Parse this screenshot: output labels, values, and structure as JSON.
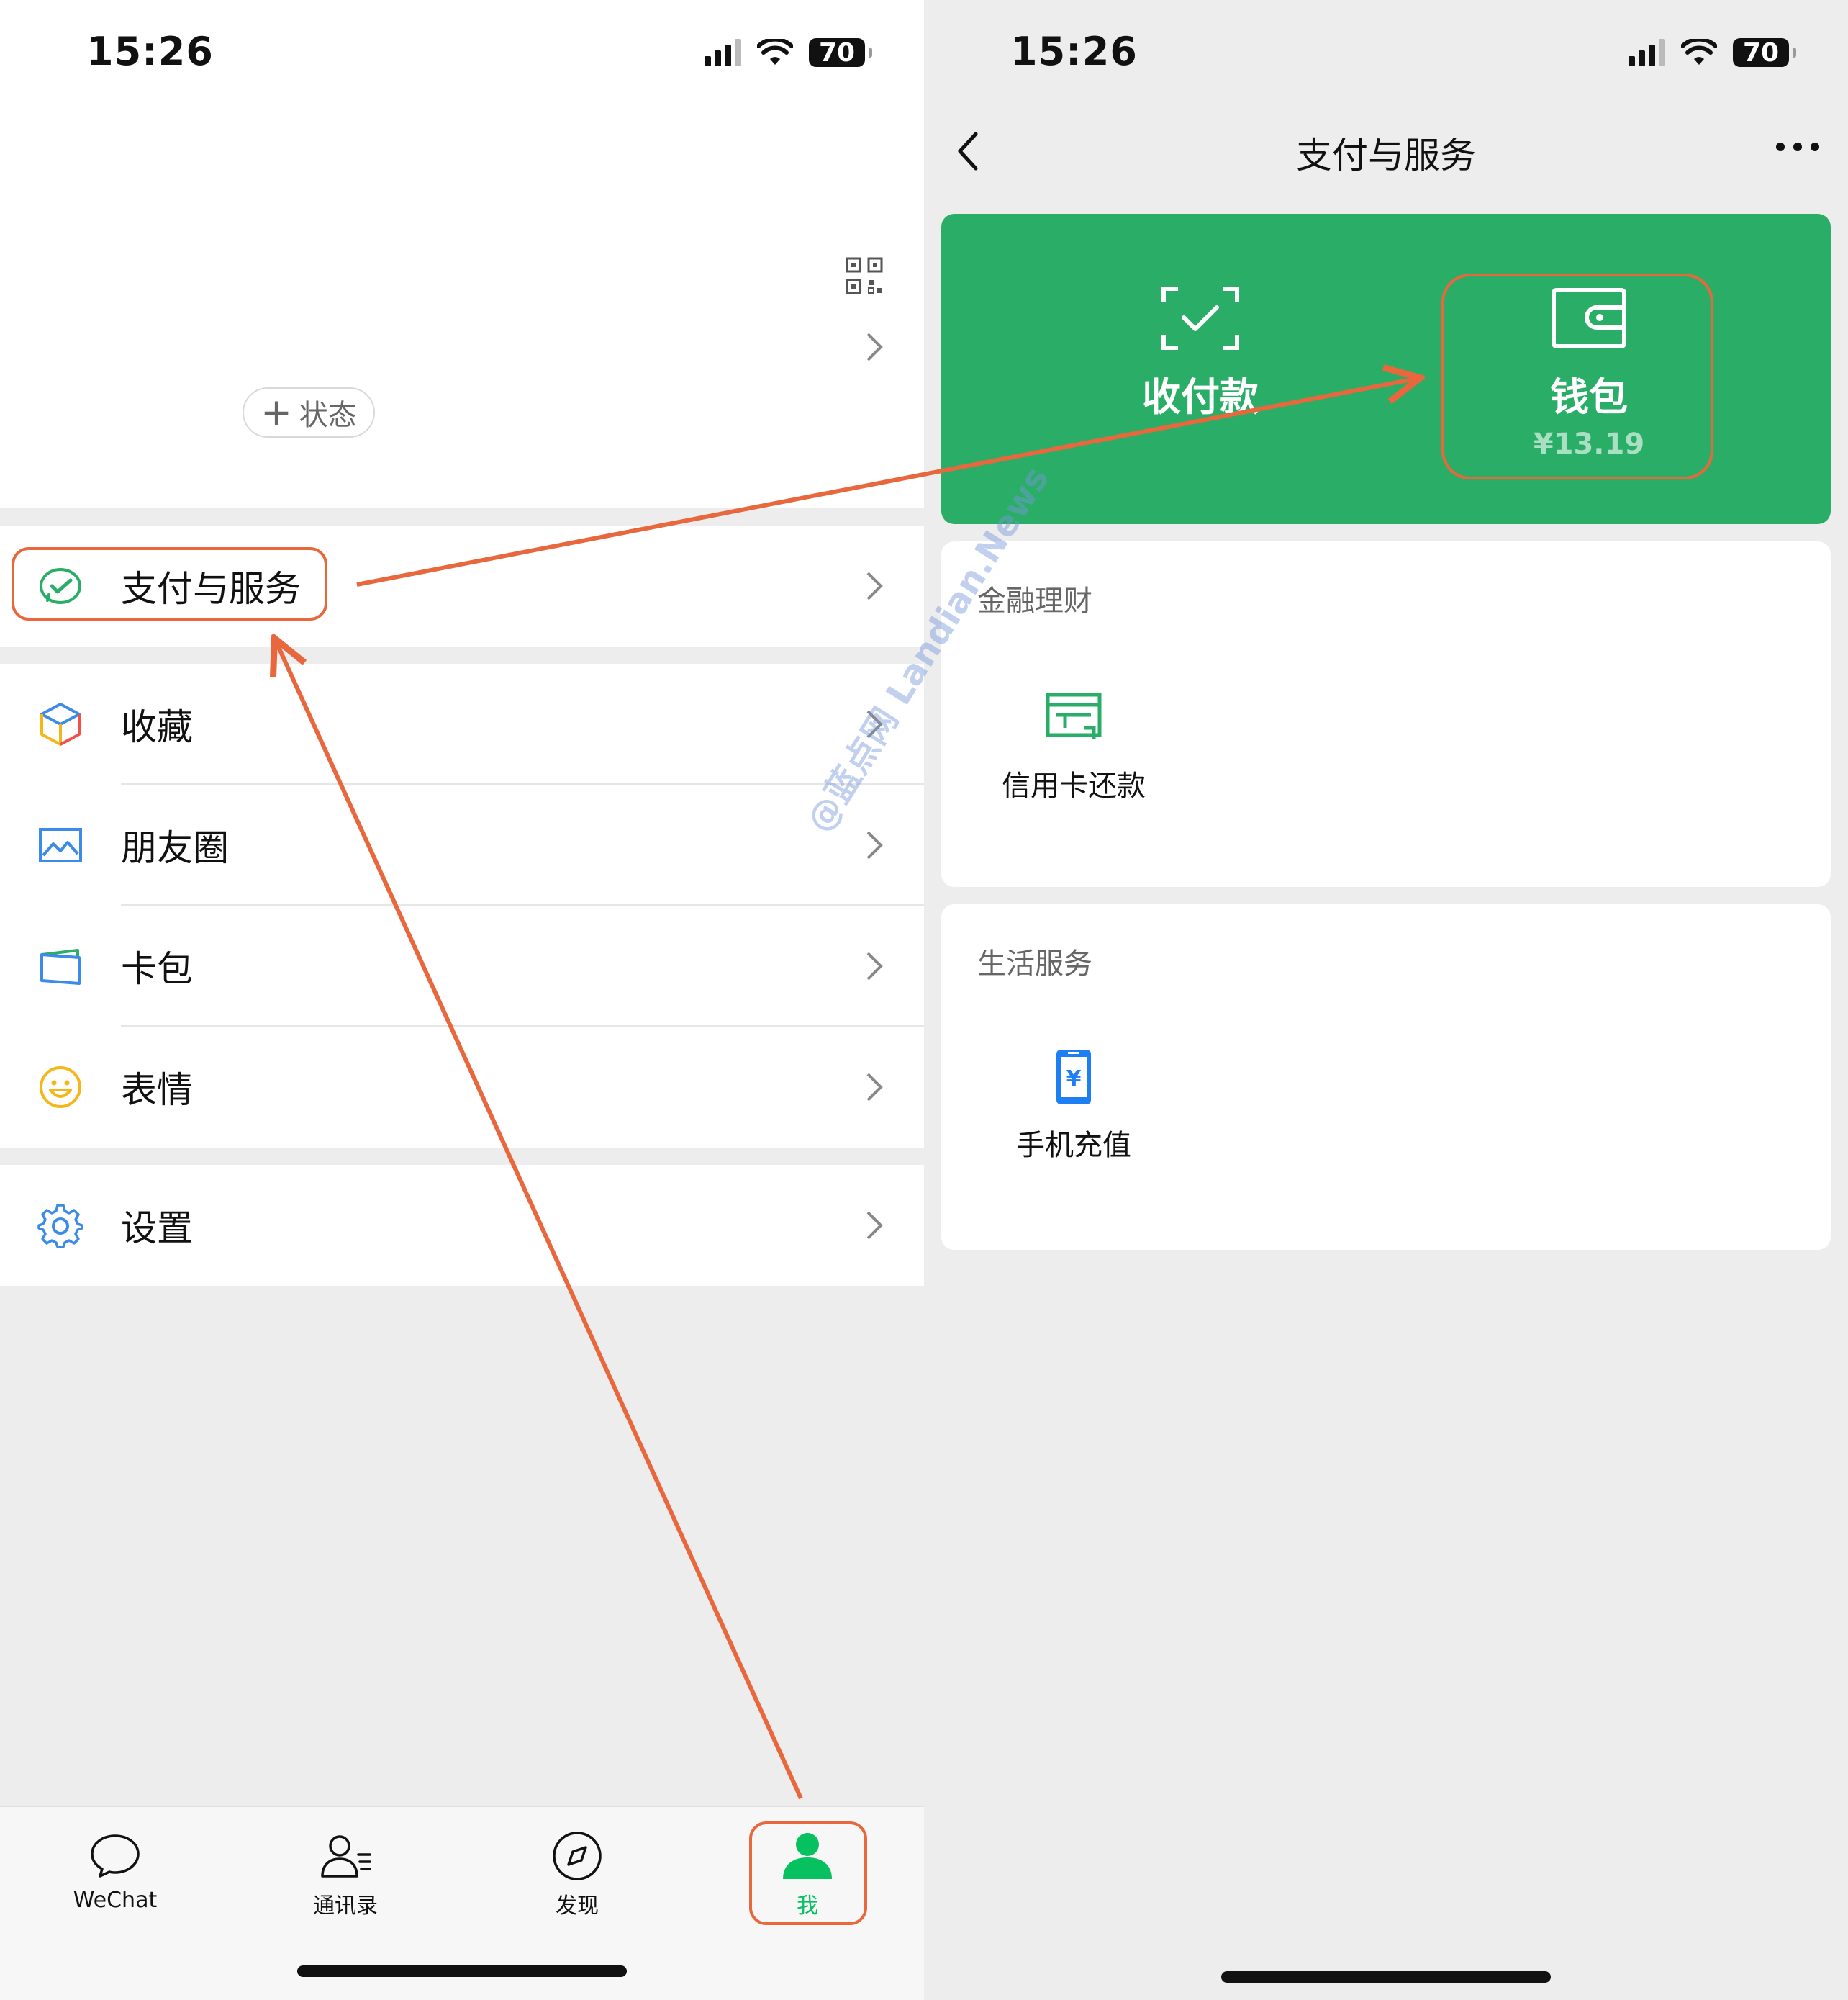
{
  "left": {
    "status_bar": {
      "time": "15:26",
      "battery": "70"
    },
    "profile": {
      "status_button": "状态"
    },
    "menu": [
      {
        "label": "支付与服务"
      },
      {
        "label": "收藏"
      },
      {
        "label": "朋友圈"
      },
      {
        "label": "卡包"
      },
      {
        "label": "表情"
      },
      {
        "label": "设置"
      }
    ],
    "tabbar": [
      {
        "label": "WeChat"
      },
      {
        "label": "通讯录"
      },
      {
        "label": "发现"
      },
      {
        "label": "我"
      }
    ]
  },
  "right": {
    "status_bar": {
      "time": "15:26",
      "battery": "70"
    },
    "nav": {
      "title": "支付与服务"
    },
    "green_card": {
      "pay": {
        "label": "收付款"
      },
      "wallet": {
        "label": "钱包",
        "balance": "¥13.19"
      }
    },
    "sections": [
      {
        "title": "金融理财",
        "items": [
          {
            "label": "信用卡还款"
          }
        ]
      },
      {
        "title": "生活服务",
        "items": [
          {
            "label": "手机充值"
          }
        ]
      }
    ]
  },
  "watermark": "@蓝点网 Landian.News",
  "colors": {
    "wechat_green": "#07c160",
    "card_green": "#2aae67",
    "annotation": "#e8673c"
  }
}
